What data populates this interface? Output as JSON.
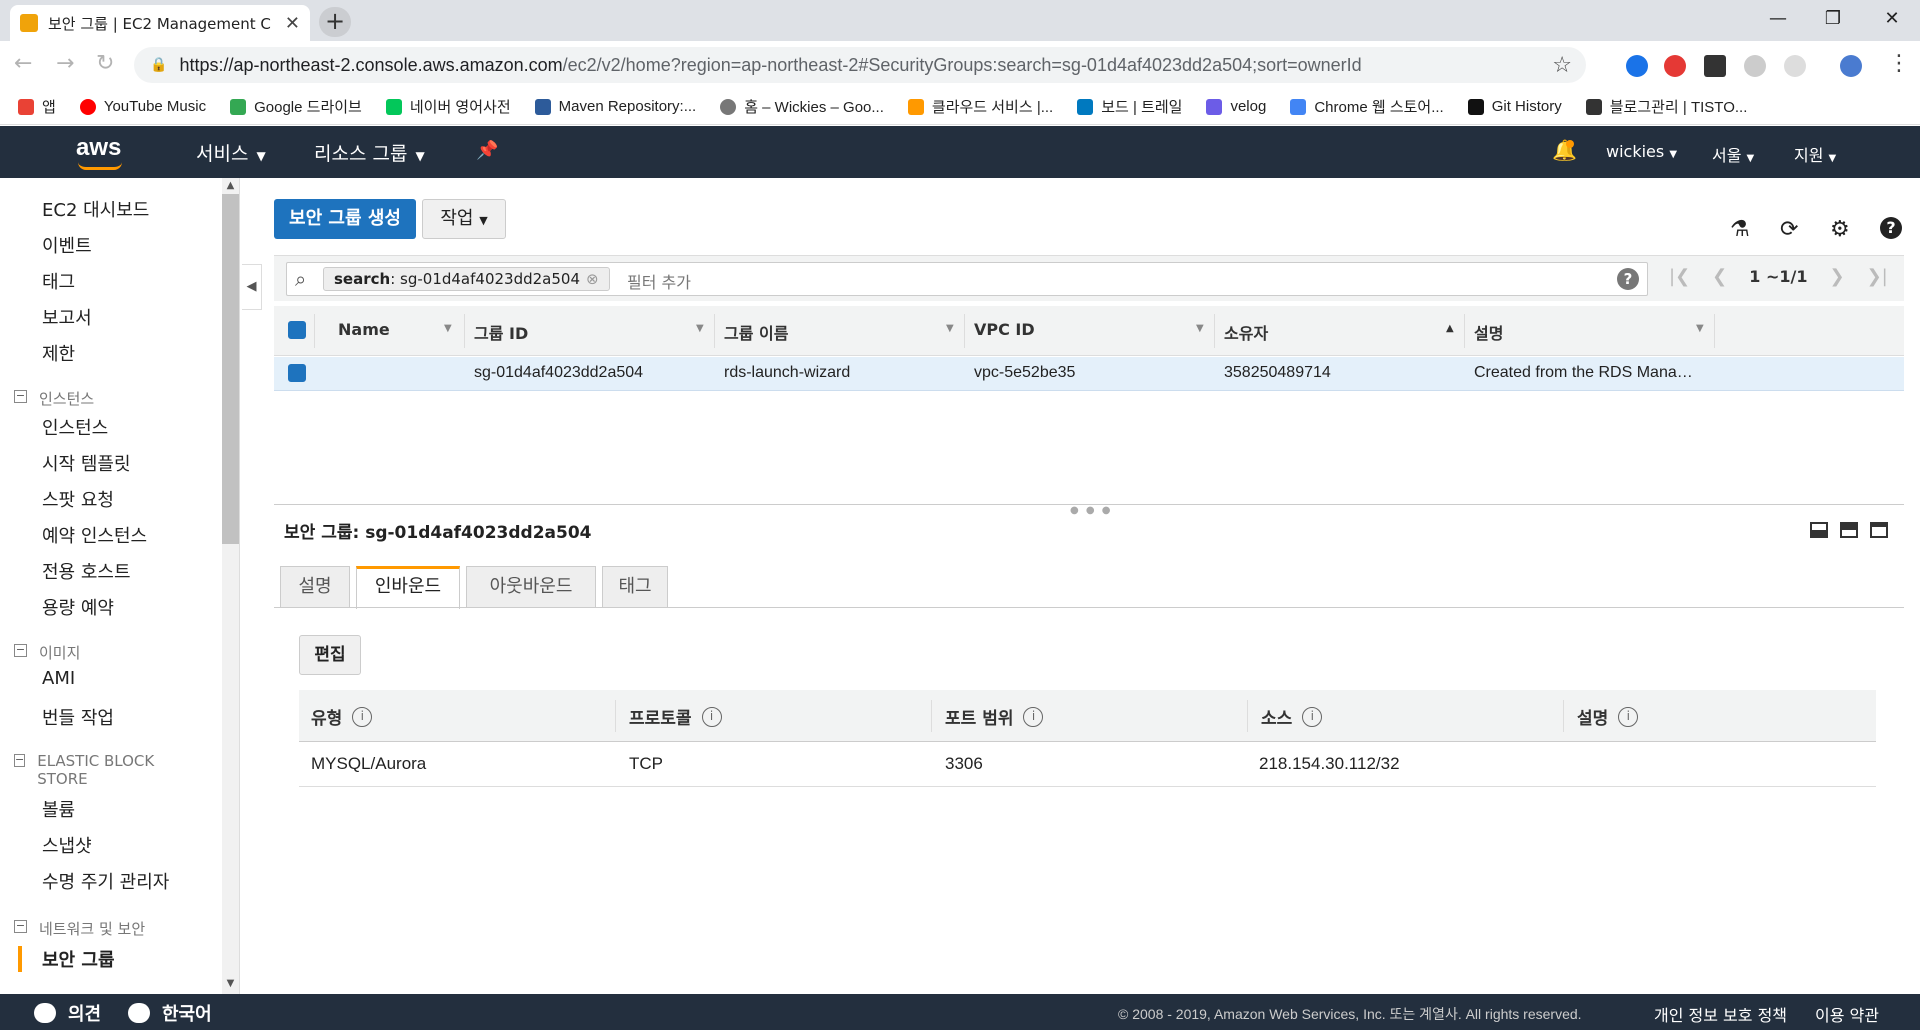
{
  "browser": {
    "tab_title": "보안 그룹 | EC2 Management C",
    "url_main": "https://ap-northeast-2.console.aws.amazon.com",
    "url_rest": "/ec2/v2/home?region=ap-northeast-2#SecurityGroups:search=sg-01d4af4023dd2a504;sort=ownerId",
    "bookmarks": [
      "앱",
      "YouTube Music",
      "Google 드라이브",
      "네이버 영어사전",
      "Maven Repository:...",
      "홈 – Wickies – Goo...",
      "클라우드 서비스 |...",
      "보드 | 트레일",
      "velog",
      "Chrome 웹 스토어...",
      "Git History",
      "블로그관리 | TISTO..."
    ],
    "bookmark_colors": [
      "#e94235",
      "#ff0000",
      "#34a853",
      "#03c75a",
      "#2d5b9a",
      "#777777",
      "#ff9900",
      "#0079bf",
      "#6c5ce7",
      "#4285f4",
      "#111111",
      "#333333"
    ]
  },
  "aws_nav": {
    "logo": "aws",
    "services": "서비스",
    "resource_groups": "리소스 그룹",
    "user": "wickies",
    "region": "서울",
    "support": "지원"
  },
  "sidebar": {
    "top_items": [
      "EC2 대시보드",
      "이벤트",
      "태그",
      "보고서",
      "제한"
    ],
    "sections": [
      {
        "title": "인스턴스",
        "items": [
          "인스턴스",
          "시작 템플릿",
          "스팟 요청",
          "예약 인스턴스",
          "전용 호스트",
          "용량 예약"
        ]
      },
      {
        "title": "이미지",
        "items": [
          "AMI",
          "번들 작업"
        ]
      },
      {
        "title": "ELASTIC BLOCK STORE",
        "items": [
          "볼륨",
          "스냅샷",
          "수명 주기 관리자"
        ]
      },
      {
        "title": "네트워크 및 보안",
        "items": [
          "보안 그룹"
        ]
      }
    ]
  },
  "toolbar": {
    "create_label": "보안 그룹 생성",
    "actions_label": "작업"
  },
  "search": {
    "token_key": "search",
    "token_value": ": sg-01d4af4023dd2a504",
    "placeholder": "필터 추가",
    "pager": "1 ~1/1"
  },
  "table": {
    "columns": [
      "Name",
      "그룹 ID",
      "그룹 이름",
      "VPC ID",
      "소유자",
      "설명"
    ],
    "rows": [
      {
        "name": "",
        "group_id": "sg-01d4af4023dd2a504",
        "group_name": "rds-launch-wizard",
        "vpc_id": "vpc-5e52be35",
        "owner": "358250489714",
        "description": "Created from the RDS Mana…"
      }
    ]
  },
  "detail": {
    "title": "보안 그룹: sg-01d4af4023dd2a504",
    "tabs": [
      "설명",
      "인바운드",
      "아웃바운드",
      "태그"
    ],
    "active_tab": "인바운드",
    "edit_label": "편집",
    "rule_columns": [
      "유형",
      "프로토콜",
      "포트 범위",
      "소스",
      "설명"
    ],
    "rules": [
      {
        "type": "MYSQL/Aurora",
        "protocol": "TCP",
        "port": "3306",
        "source": "218.154.30.112/32",
        "description": ""
      }
    ]
  },
  "footer": {
    "feedback": "의견",
    "language": "한국어",
    "copyright": "© 2008 - 2019, Amazon Web Services, Inc. 또는 계열사. All rights reserved.",
    "privacy": "개인 정보 보호 정책",
    "terms": "이용 약관"
  },
  "colors": {
    "aws_dark": "#232f3e",
    "aws_orange": "#ff9900",
    "primary_blue": "#1e73be"
  }
}
